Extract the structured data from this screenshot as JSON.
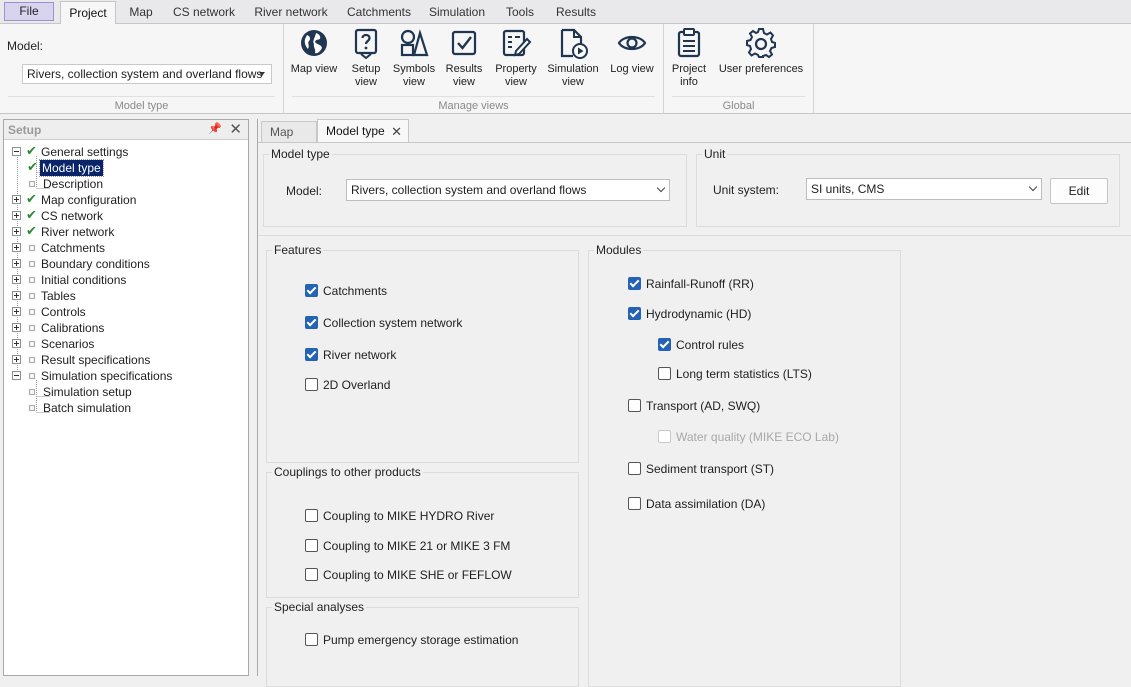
{
  "menu": {
    "file": "File",
    "tabs": [
      "Project",
      "Map",
      "CS network",
      "River network",
      "Catchments",
      "Simulation",
      "Tools",
      "Results"
    ],
    "active": "Project"
  },
  "ribbon": {
    "model_label": "Model:",
    "model_value": "Rivers, collection system and overland flows",
    "groups": {
      "model_type": "Model type",
      "manage_views": "Manage views",
      "global": "Global"
    },
    "buttons": {
      "map_view": [
        "Map view"
      ],
      "setup_view": [
        "Setup",
        "view"
      ],
      "symbols_view": [
        "Symbols",
        "view"
      ],
      "results_view": [
        "Results",
        "view"
      ],
      "property_view": [
        "Property",
        "view"
      ],
      "simulation_view": [
        "Simulation",
        "view"
      ],
      "log_view": [
        "Log view"
      ],
      "project_info": [
        "Project",
        "info"
      ],
      "user_preferences": [
        "User preferences"
      ]
    }
  },
  "setup": {
    "title": "Setup",
    "tree": [
      {
        "label": "General settings",
        "state": "checked",
        "expander": "minus"
      },
      {
        "label": "Model type",
        "state": "checked",
        "child": true,
        "selected": true
      },
      {
        "label": "Description",
        "state": "empty",
        "child": true
      },
      {
        "label": "Map configuration",
        "state": "checked",
        "expander": "plus"
      },
      {
        "label": "CS network",
        "state": "checked",
        "expander": "plus"
      },
      {
        "label": "River network",
        "state": "checked",
        "expander": "plus"
      },
      {
        "label": "Catchments",
        "state": "empty",
        "expander": "plus"
      },
      {
        "label": "Boundary conditions",
        "state": "empty",
        "expander": "plus"
      },
      {
        "label": "Initial conditions",
        "state": "empty",
        "expander": "plus"
      },
      {
        "label": "Tables",
        "state": "empty",
        "expander": "plus"
      },
      {
        "label": "Controls",
        "state": "empty",
        "expander": "plus"
      },
      {
        "label": "Calibrations",
        "state": "empty",
        "expander": "plus"
      },
      {
        "label": "Scenarios",
        "state": "empty",
        "expander": "plus"
      },
      {
        "label": "Result specifications",
        "state": "empty",
        "expander": "plus"
      },
      {
        "label": "Simulation specifications",
        "state": "empty",
        "expander": "minus"
      },
      {
        "label": "Simulation setup",
        "state": "empty",
        "child": true
      },
      {
        "label": "Batch simulation",
        "state": "empty",
        "child": true
      }
    ]
  },
  "doctabs": {
    "map": "Map",
    "model_type": "Model type"
  },
  "model_type": {
    "group": "Model type",
    "label": "Model:",
    "value": "Rivers, collection system and overland flows"
  },
  "unit": {
    "group": "Unit",
    "label": "Unit system:",
    "value": "SI units, CMS",
    "edit": "Edit"
  },
  "features": {
    "group": "Features",
    "items": [
      {
        "label": "Catchments",
        "checked": true
      },
      {
        "label": "Collection system network",
        "checked": true
      },
      {
        "label": "River network",
        "checked": true
      },
      {
        "label": "2D Overland",
        "checked": false
      }
    ]
  },
  "couplings": {
    "group": "Couplings to other products",
    "items": [
      {
        "label": "Coupling to MIKE HYDRO River",
        "checked": false
      },
      {
        "label": "Coupling to MIKE 21 or MIKE 3 FM",
        "checked": false
      },
      {
        "label": "Coupling to MIKE SHE or FEFLOW",
        "checked": false
      }
    ]
  },
  "special": {
    "group": "Special analyses",
    "items": [
      {
        "label": "Pump emergency storage estimation",
        "checked": false
      }
    ]
  },
  "modules": {
    "group": "Modules",
    "items": [
      {
        "label": "Rainfall-Runoff (RR)",
        "checked": true
      },
      {
        "label": "Hydrodynamic (HD)",
        "checked": true
      },
      {
        "label": "Control rules",
        "checked": true
      },
      {
        "label": "Long term statistics (LTS)",
        "checked": false
      },
      {
        "label": "Transport (AD, SWQ)",
        "checked": false
      },
      {
        "label": "Water quality (MIKE ECO Lab)",
        "checked": false,
        "disabled": true
      },
      {
        "label": "Sediment transport (ST)",
        "checked": false
      },
      {
        "label": "Data assimilation (DA)",
        "checked": false
      }
    ]
  },
  "colors": {
    "accent": "#2462b6",
    "selection": "#0a246a",
    "tick": "#2e8a2e"
  }
}
